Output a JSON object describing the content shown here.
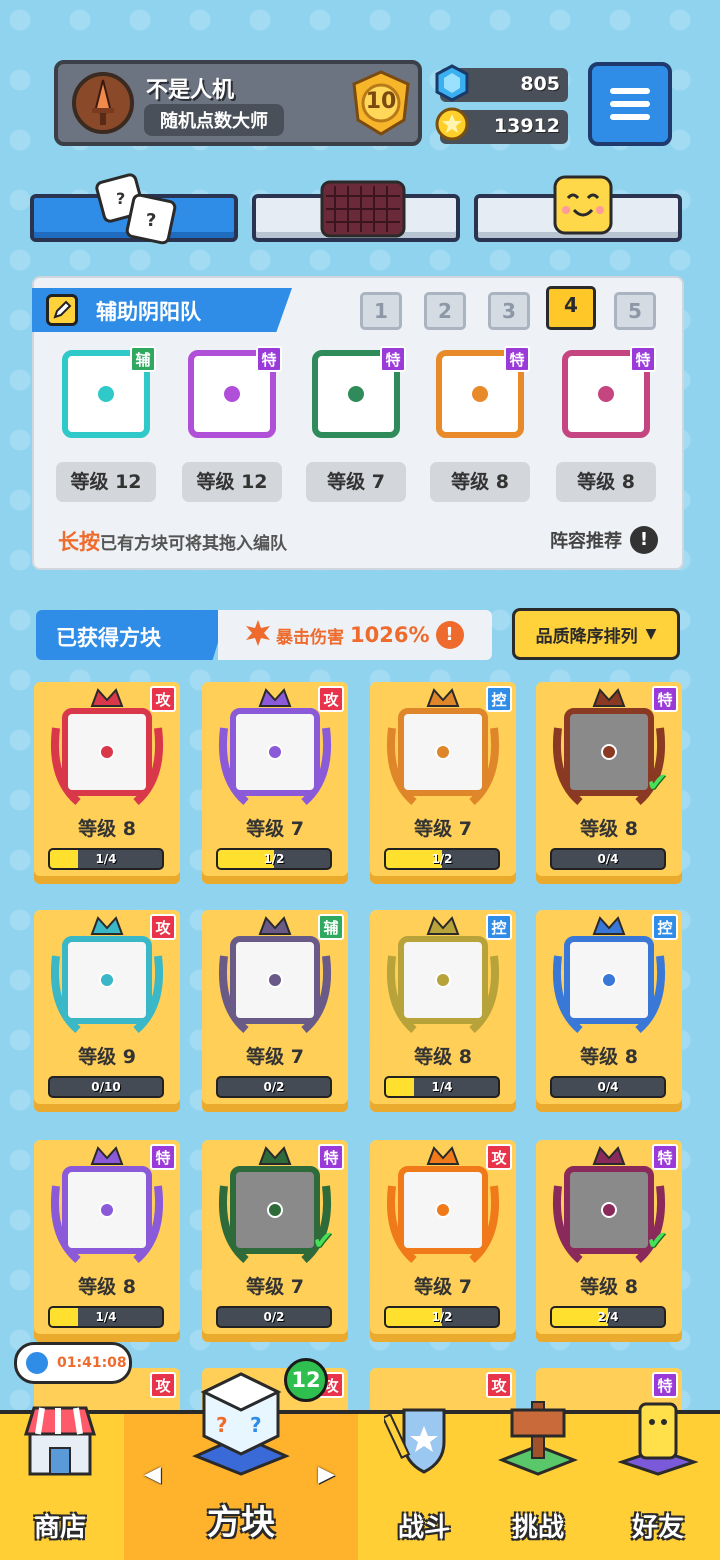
{
  "player": {
    "name": "不是人机",
    "title": "随机点数大师",
    "rank": "10"
  },
  "currencies": {
    "gems": "805",
    "coins": "13912"
  },
  "lineup": {
    "title": "辅助阴阳队",
    "team_tabs": [
      "1",
      "2",
      "3",
      "4",
      "5"
    ],
    "active_team": "4",
    "slots": [
      {
        "tag": "辅",
        "level": "等级 12",
        "color": "#2fc9c9"
      },
      {
        "tag": "特",
        "level": "等级 12",
        "color": "#b04fd8"
      },
      {
        "tag": "特",
        "level": "等级 7",
        "color": "#2f8c5a"
      },
      {
        "tag": "特",
        "level": "等级 8",
        "color": "#e88a2a"
      },
      {
        "tag": "特",
        "level": "等级 8",
        "color": "#c4457f"
      }
    ],
    "hint_highlight": "长按",
    "hint_text": "已有方块可将其拖入编队",
    "recommend": "阵容推荐",
    "info_glyph": "!"
  },
  "obtained": {
    "title": "已获得方块",
    "crit_label": "暴击伤害",
    "crit_value": "1026%",
    "sort": "品质降序排列",
    "sort_arrow": "▼",
    "cards": [
      {
        "tag": "攻",
        "level": "等级 8",
        "progress": "1/4",
        "fill": 0.25,
        "color": "#d8384a",
        "owned": false
      },
      {
        "tag": "攻",
        "level": "等级 7",
        "progress": "1/2",
        "fill": 0.5,
        "color": "#8a5ad8",
        "owned": false
      },
      {
        "tag": "控",
        "level": "等级 7",
        "progress": "1/2",
        "fill": 0.5,
        "color": "#e0862a",
        "owned": false
      },
      {
        "tag": "特",
        "level": "等级 8",
        "progress": "0/4",
        "fill": 0,
        "color": "#8a3a22",
        "owned": true
      },
      {
        "tag": "攻",
        "level": "等级 9",
        "progress": "0/10",
        "fill": 0,
        "color": "#3ab8c8",
        "owned": false
      },
      {
        "tag": "辅",
        "level": "等级 7",
        "progress": "0/2",
        "fill": 0,
        "color": "#6a5a88",
        "owned": false
      },
      {
        "tag": "控",
        "level": "等级 8",
        "progress": "1/4",
        "fill": 0.25,
        "color": "#b8a23a",
        "owned": false
      },
      {
        "tag": "控",
        "level": "等级 8",
        "progress": "0/4",
        "fill": 0,
        "color": "#3a78d8",
        "owned": false
      },
      {
        "tag": "特",
        "level": "等级 8",
        "progress": "1/4",
        "fill": 0.25,
        "color": "#8a5ad8",
        "owned": false
      },
      {
        "tag": "特",
        "level": "等级 7",
        "progress": "0/2",
        "fill": 0,
        "color": "#2f6a3a",
        "owned": true
      },
      {
        "tag": "攻",
        "level": "等级 7",
        "progress": "1/2",
        "fill": 0.5,
        "color": "#f07a1a",
        "owned": false
      },
      {
        "tag": "特",
        "level": "等级 8",
        "progress": "2/4",
        "fill": 0.5,
        "color": "#8a2a5a",
        "owned": true
      }
    ],
    "partial_row_tags": [
      "攻",
      "攻",
      "攻",
      "特"
    ]
  },
  "tag_colors": {
    "攻": "#e8334a",
    "控": "#2f8de8",
    "特": "#9a3ad8",
    "辅": "#2fa860"
  },
  "timer": "01:41:08",
  "nav": {
    "shop": "商店",
    "blocks": "方块",
    "battle": "战斗",
    "challenge": "挑战",
    "friends": "好友",
    "blocks_badge": "12"
  }
}
